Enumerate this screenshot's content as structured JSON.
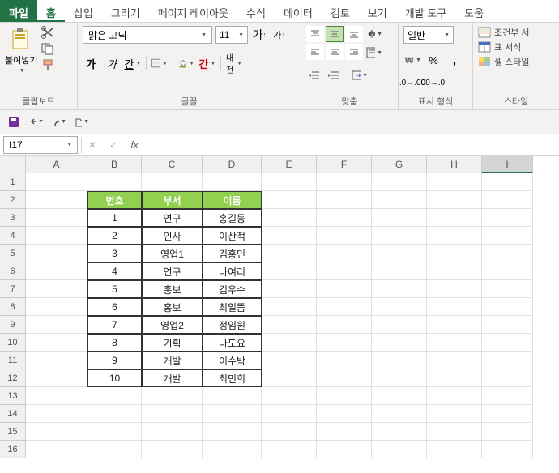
{
  "tabs": [
    "파일",
    "홈",
    "삽입",
    "그리기",
    "페이지 레이아웃",
    "수식",
    "데이터",
    "검토",
    "보기",
    "개발 도구",
    "도움"
  ],
  "active_tab": 1,
  "ribbon": {
    "clipboard": {
      "label": "클립보드",
      "paste": "붙여넣기"
    },
    "font": {
      "label": "글꼴",
      "name": "맑은 고딕",
      "size": "11"
    },
    "align": {
      "label": "맞춤"
    },
    "number": {
      "label": "표시 형식",
      "format": "일반"
    },
    "style": {
      "label": "스타일",
      "cond": "조건부 서",
      "tbl": "표 서식",
      "cell": "셀 스타일"
    }
  },
  "name_box": "I17",
  "columns": [
    "A",
    "B",
    "C",
    "D",
    "E",
    "F",
    "G",
    "H",
    "I"
  ],
  "selected_col": "I",
  "table": {
    "headers": [
      "번호",
      "부서",
      "이름"
    ],
    "rows": [
      [
        "1",
        "연구",
        "홍길동"
      ],
      [
        "2",
        "인사",
        "이산적"
      ],
      [
        "3",
        "영업1",
        "김홍민"
      ],
      [
        "4",
        "연구",
        "나여리"
      ],
      [
        "5",
        "홍보",
        "김우수"
      ],
      [
        "6",
        "홍보",
        "최일뜸"
      ],
      [
        "7",
        "영업2",
        "정임원"
      ],
      [
        "8",
        "기획",
        "나도요"
      ],
      [
        "9",
        "개발",
        "이수박"
      ],
      [
        "10",
        "개발",
        "최민희"
      ]
    ]
  },
  "row_count": 16
}
